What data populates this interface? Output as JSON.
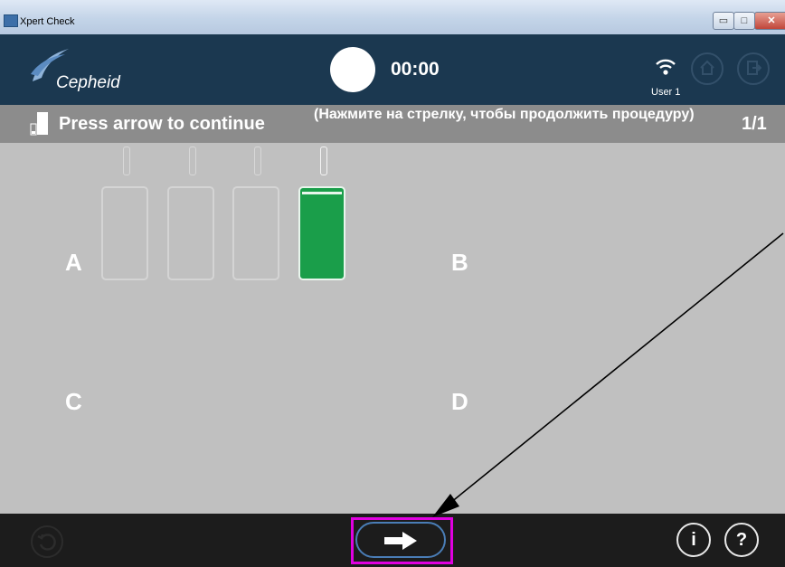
{
  "window": {
    "title": "Xpert Check",
    "min_glyph": "▭",
    "max_glyph": "□",
    "close_glyph": "✕"
  },
  "header": {
    "logo_text": "Cepheid",
    "timer": "00:00",
    "user": "User 1",
    "icons": [
      "wifi-icon",
      "home-icon",
      "exit-icon"
    ]
  },
  "instruction": {
    "main": "Press arrow to continue",
    "sub": "(Нажмите на стрелку, чтобы продолжить процедуру)",
    "page": "1/1"
  },
  "modules": {
    "a": "A",
    "b": "B",
    "c": "C",
    "d": "D",
    "slots": [
      {
        "state": "empty"
      },
      {
        "state": "empty"
      },
      {
        "state": "empty"
      },
      {
        "state": "active",
        "color": "#1a9e4a"
      }
    ]
  },
  "footer": {
    "info": "i",
    "help": "?",
    "highlight_color": "#e000e0",
    "icons": [
      "refresh-icon",
      "arrow-right-icon"
    ]
  },
  "colors": {
    "header": "#1b3850",
    "instruction_bar": "#8c8c8c",
    "main": "#c0c0c0",
    "footer": "#1c1c1c"
  }
}
